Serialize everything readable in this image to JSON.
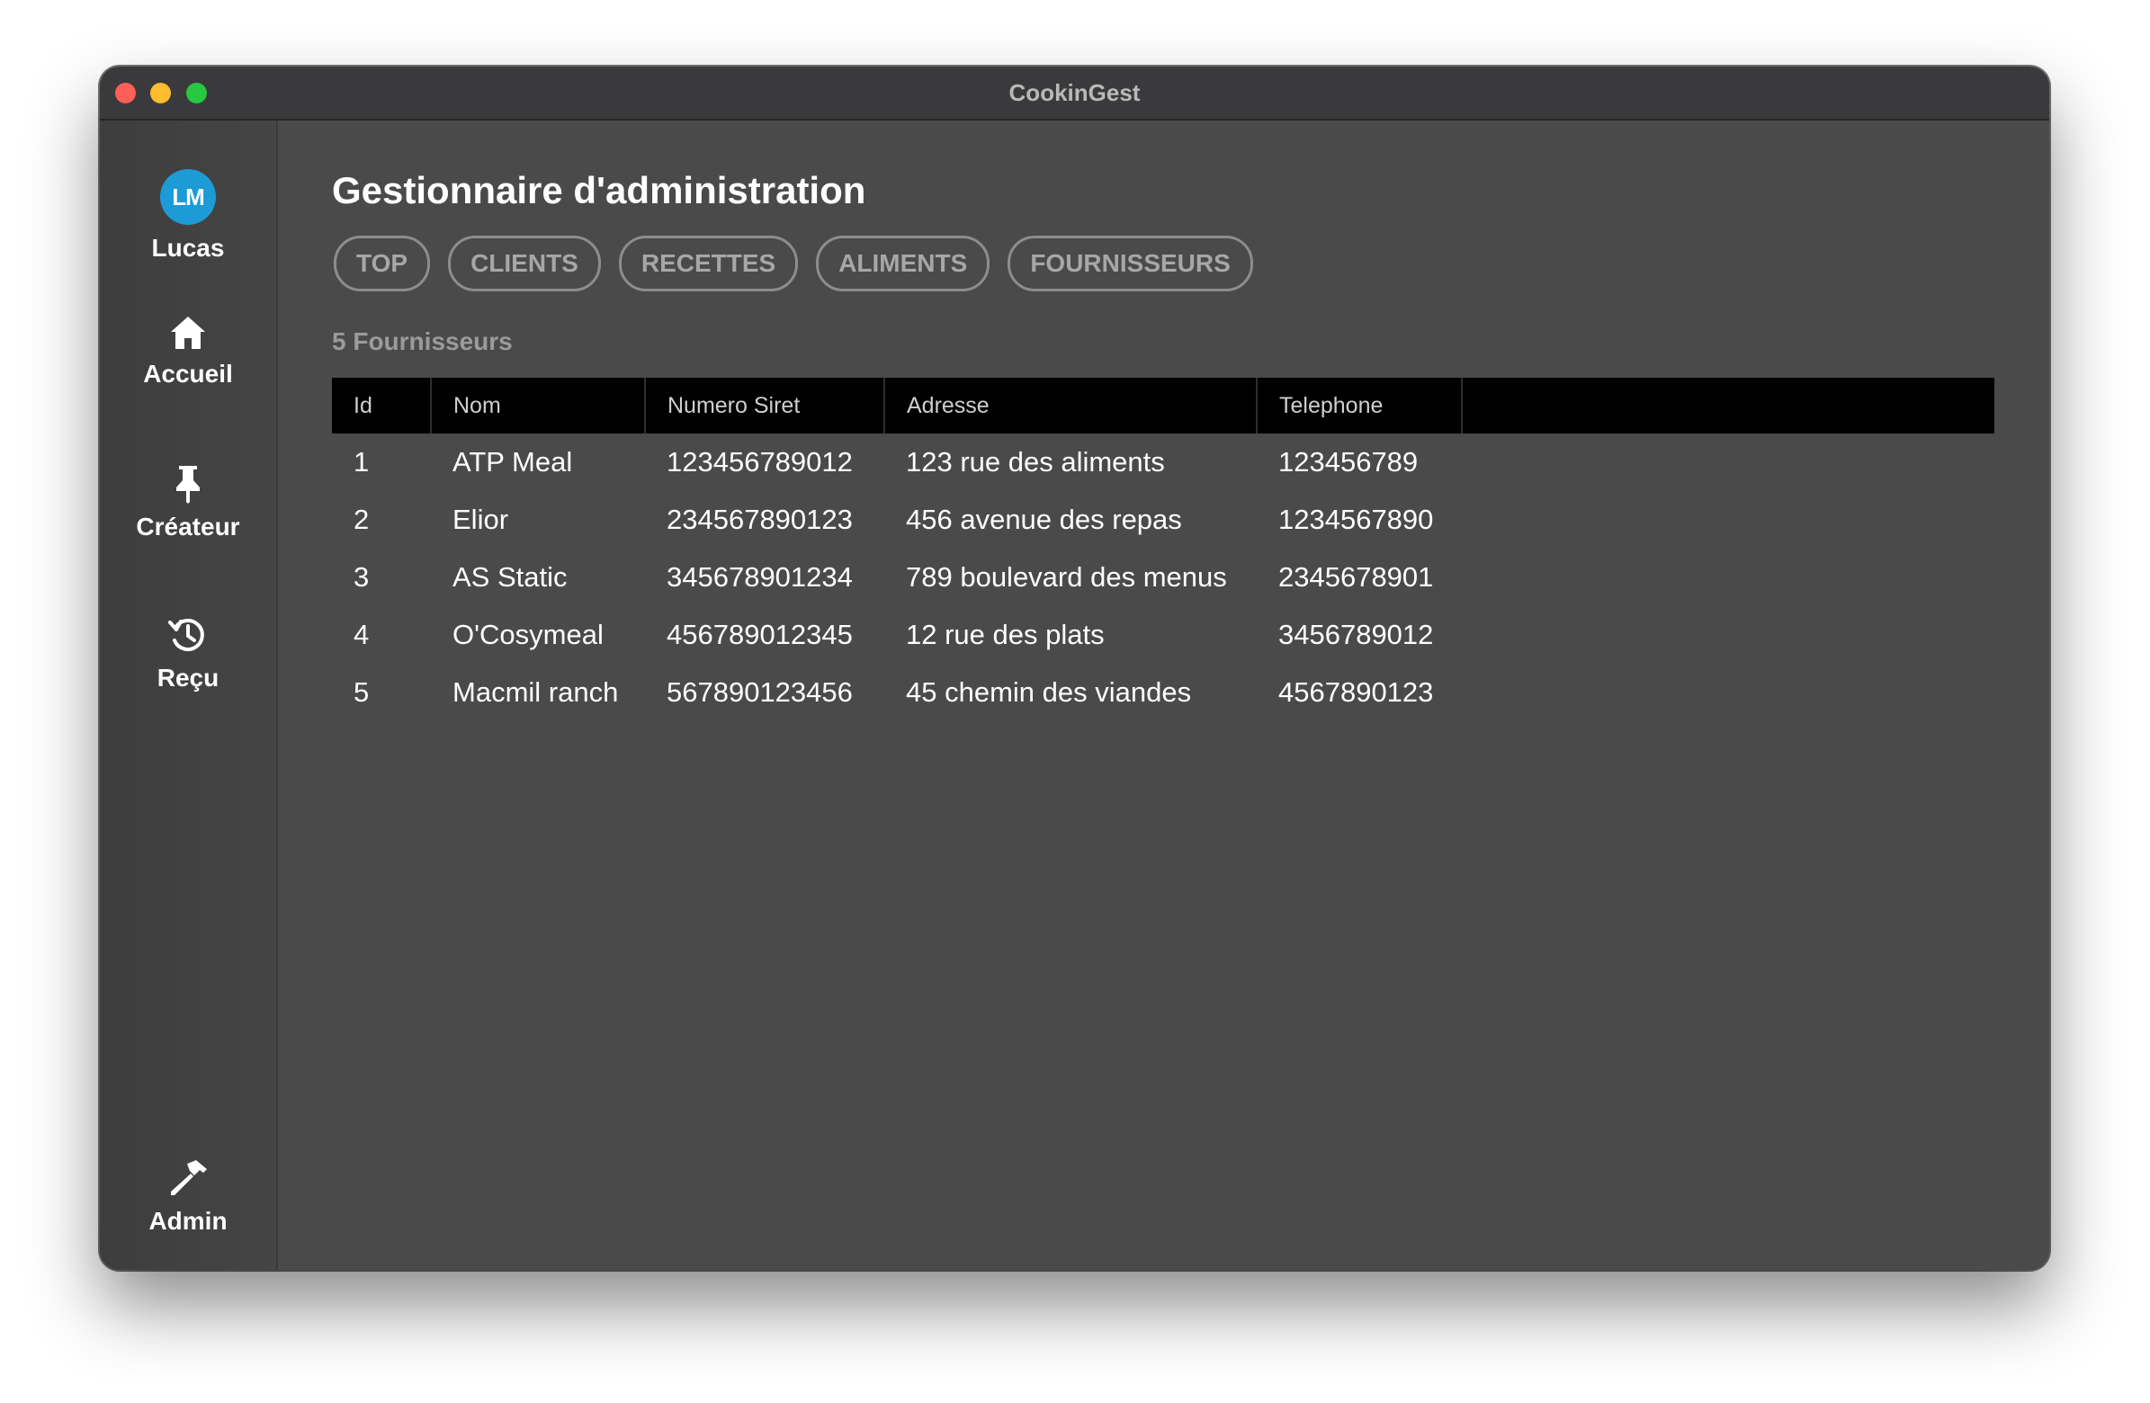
{
  "window": {
    "title": "CookinGest"
  },
  "sidebar": {
    "user": {
      "initials": "LM",
      "name": "Lucas"
    },
    "items": [
      {
        "label": "Accueil",
        "icon": "home-icon"
      },
      {
        "label": "Créateur",
        "icon": "pin-icon"
      },
      {
        "label": "Reçu",
        "icon": "history-icon"
      }
    ],
    "admin": {
      "label": "Admin",
      "icon": "hammer-icon"
    }
  },
  "main": {
    "title": "Gestionnaire d'administration",
    "tabs": [
      {
        "label": "TOP"
      },
      {
        "label": "CLIENTS"
      },
      {
        "label": "RECETTES"
      },
      {
        "label": "ALIMENTS"
      },
      {
        "label": "FOURNISSEURS"
      }
    ],
    "count_label": "5 Fournisseurs",
    "table": {
      "columns": [
        "Id",
        "Nom",
        "Numero Siret",
        "Adresse",
        "Telephone"
      ],
      "rows": [
        [
          "1",
          "ATP Meal",
          "123456789012",
          "123 rue des aliments",
          "123456789"
        ],
        [
          "2",
          "Elior",
          "234567890123",
          "456 avenue des repas",
          "1234567890"
        ],
        [
          "3",
          "AS Static",
          "345678901234",
          "789 boulevard des menus",
          "2345678901"
        ],
        [
          "4",
          "O'Cosymeal",
          "456789012345",
          "12 rue des plats",
          "3456789012"
        ],
        [
          "5",
          "Macmil ranch",
          "567890123456",
          "45 chemin des viandes",
          "4567890123"
        ]
      ]
    }
  },
  "colors": {
    "avatar": "#1c9bd6",
    "content_bg": "#4a4a4a",
    "table_header_bg": "#000000"
  }
}
